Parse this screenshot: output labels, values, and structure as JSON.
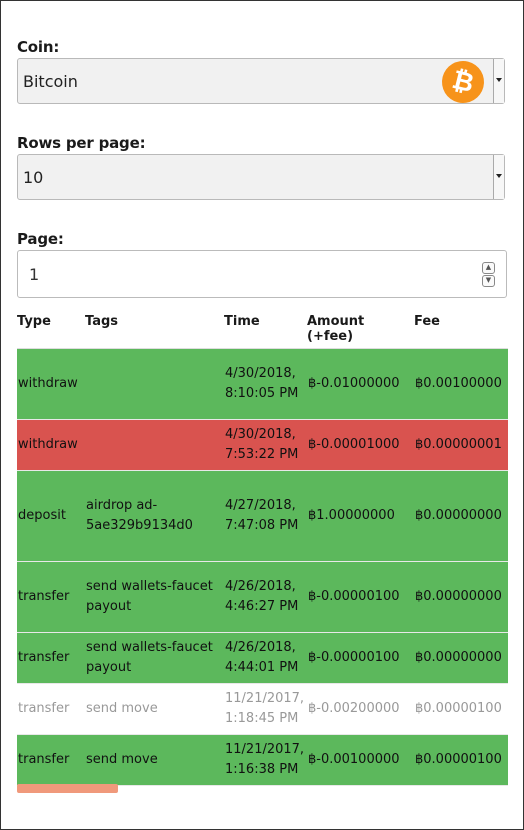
{
  "coin": {
    "label": "Coin:",
    "selected": "Bitcoin",
    "icon": "bitcoin-icon",
    "icon_glyph": "₿"
  },
  "rows_per_page": {
    "label": "Rows per page:",
    "selected": "10"
  },
  "page": {
    "label": "Page:",
    "value": "1"
  },
  "table": {
    "headers": [
      "Type",
      "Tags",
      "Time",
      "Amount (+fee)",
      "Fee"
    ],
    "rows": [
      {
        "status": "green",
        "type": "withdraw",
        "tags": "",
        "time": "4/30/2018, 8:10:05 PM",
        "amount": "฿-0.01000000",
        "fee": "฿0.00100000"
      },
      {
        "status": "red",
        "type": "withdraw",
        "tags": "",
        "time": "4/30/2018, 7:53:22 PM",
        "amount": "฿-0.00001000",
        "fee": "฿0.00000001"
      },
      {
        "status": "green",
        "type": "deposit",
        "tags": "airdrop ad-5ae329b9134d0",
        "time": "4/27/2018, 7:47:08 PM",
        "amount": "฿1.00000000",
        "fee": "฿0.00000000"
      },
      {
        "status": "green",
        "type": "transfer",
        "tags": "send wallets-faucet payout",
        "time": "4/26/2018, 4:46:27 PM",
        "amount": "฿-0.00000100",
        "fee": "฿0.00000000"
      },
      {
        "status": "green",
        "type": "transfer",
        "tags": "send wallets-faucet payout",
        "time": "4/26/2018, 4:44:01 PM",
        "amount": "฿-0.00000100",
        "fee": "฿0.00000000"
      },
      {
        "status": "plain",
        "type": "transfer",
        "tags": "send move",
        "time": "11/21/2017, 1:18:45 PM",
        "amount": "฿-0.00200000",
        "fee": "฿0.00000100"
      },
      {
        "status": "green",
        "type": "transfer",
        "tags": "send move",
        "time": "11/21/2017, 1:16:38 PM",
        "amount": "฿-0.00100000",
        "fee": "฿0.00000100"
      }
    ]
  },
  "colors": {
    "success": "#5cb85c",
    "failed": "#d9534f",
    "pending_text": "#999999",
    "bitcoin": "#f7931a",
    "scrollbar": "#f0997b"
  }
}
